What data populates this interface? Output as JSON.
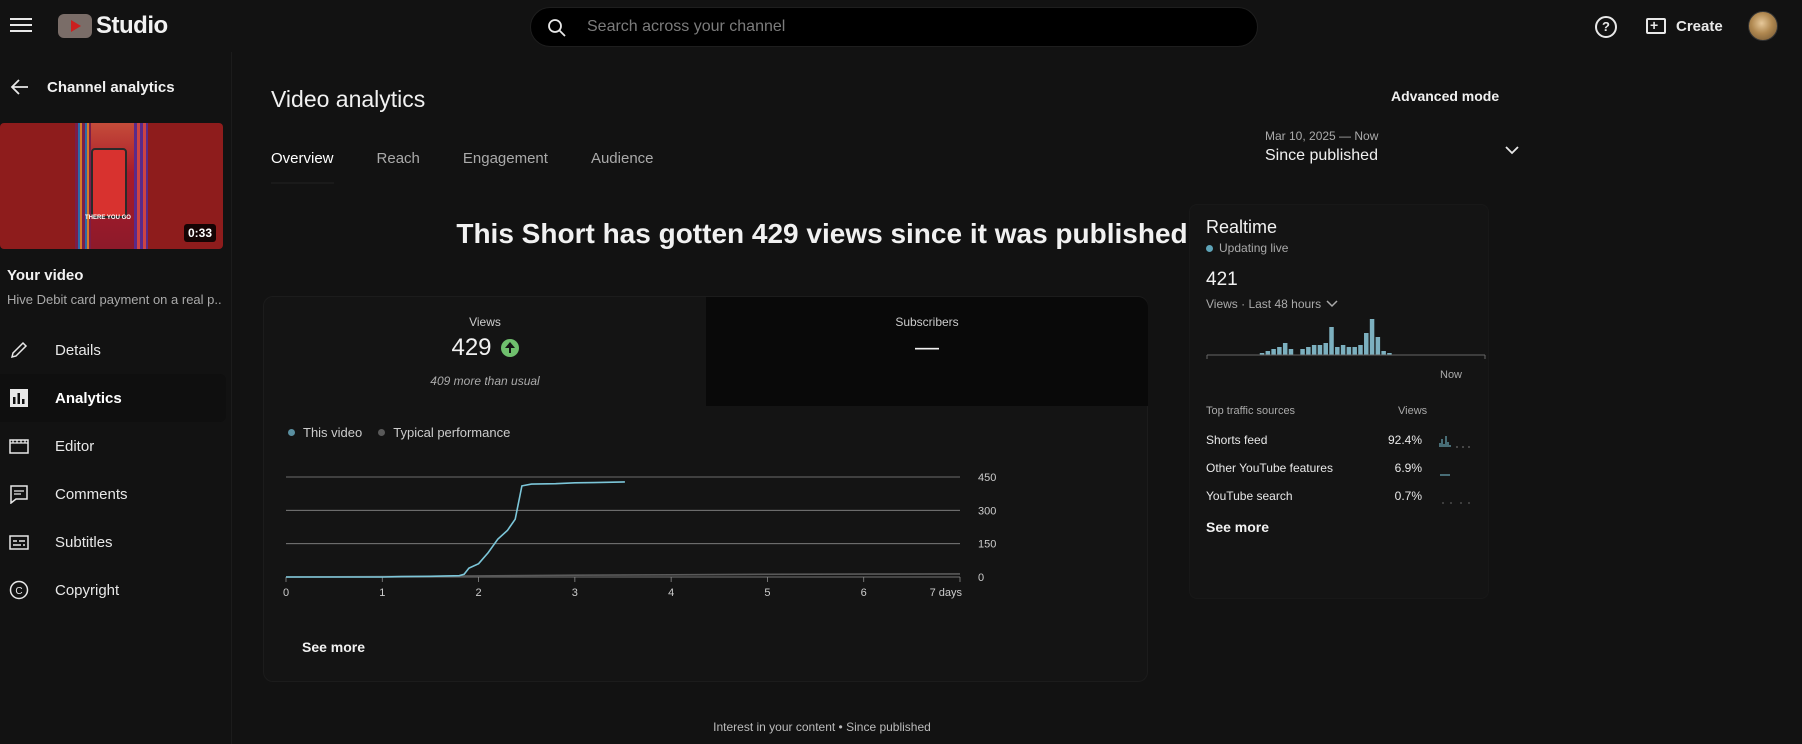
{
  "header": {
    "logo_text": "Studio",
    "search_placeholder": "Search across your channel",
    "create_label": "Create"
  },
  "sidebar": {
    "back_label": "Channel analytics",
    "thumbnail_caption": "THERE YOU GO",
    "duration": "0:33",
    "your_video_label": "Your video",
    "video_title": "Hive Debit card payment on a real p...",
    "items": [
      {
        "label": "Details",
        "icon": "pencil-icon",
        "active": false
      },
      {
        "label": "Analytics",
        "icon": "analytics-icon",
        "active": true
      },
      {
        "label": "Editor",
        "icon": "editor-icon",
        "active": false
      },
      {
        "label": "Comments",
        "icon": "comments-icon",
        "active": false
      },
      {
        "label": "Subtitles",
        "icon": "subtitles-icon",
        "active": false
      },
      {
        "label": "Copyright",
        "icon": "copyright-icon",
        "active": false
      }
    ]
  },
  "main": {
    "title": "Video analytics",
    "advanced_mode_label": "Advanced mode",
    "tabs": [
      {
        "label": "Overview",
        "active": true
      },
      {
        "label": "Reach",
        "active": false
      },
      {
        "label": "Engagement",
        "active": false
      },
      {
        "label": "Audience",
        "active": false
      }
    ],
    "date_range": {
      "range": "Mar 10, 2025 — Now",
      "label": "Since published"
    },
    "headline": "This Short has gotten 429 views since it was published",
    "metrics": {
      "views": {
        "label": "Views",
        "value": "429",
        "sub": "409 more than usual"
      },
      "subscribers": {
        "label": "Subscribers",
        "value": "—"
      }
    },
    "legend": {
      "this_video": "This video",
      "typical": "Typical performance"
    },
    "see_more_label": "See more",
    "interest_label": "Interest in your content • Since published"
  },
  "chart_data": {
    "type": "line",
    "x_tick_labels": [
      "0",
      "1",
      "2",
      "3",
      "4",
      "5",
      "6",
      "7 days"
    ],
    "y_tick_labels": [
      "450",
      "300",
      "150",
      "0"
    ],
    "xlim": [
      0,
      7
    ],
    "ylim": [
      0,
      450
    ],
    "series": [
      {
        "name": "This video",
        "color": "#7cc6d9",
        "points": [
          [
            0,
            0
          ],
          [
            0.5,
            0
          ],
          [
            1,
            0
          ],
          [
            1.2,
            2
          ],
          [
            1.5,
            3
          ],
          [
            1.8,
            6
          ],
          [
            1.85,
            12
          ],
          [
            1.9,
            40
          ],
          [
            2.0,
            60
          ],
          [
            2.1,
            110
          ],
          [
            2.2,
            170
          ],
          [
            2.3,
            210
          ],
          [
            2.38,
            260
          ],
          [
            2.45,
            410
          ],
          [
            2.55,
            418
          ],
          [
            2.8,
            420
          ],
          [
            3.0,
            424
          ],
          [
            3.2,
            425
          ],
          [
            3.52,
            428
          ]
        ]
      },
      {
        "name": "Typical performance",
        "color": "#5a5a5a",
        "points": [
          [
            0,
            0
          ],
          [
            1,
            2
          ],
          [
            2,
            5
          ],
          [
            3,
            8
          ],
          [
            4,
            10
          ],
          [
            5,
            12
          ],
          [
            6,
            13
          ],
          [
            7,
            14
          ]
        ]
      }
    ],
    "grid": true
  },
  "realtime": {
    "title": "Realtime",
    "status": "Updating live",
    "count": "421",
    "sub_label": "Views · Last 48 hours",
    "now_label": "Now",
    "bars": [
      0,
      0,
      0,
      0,
      0,
      0,
      0,
      0,
      0,
      1,
      2,
      3,
      4,
      6,
      3,
      0,
      3,
      4,
      5,
      5,
      6,
      14,
      4,
      5,
      4,
      4,
      5,
      11,
      18,
      9,
      2,
      1,
      0,
      0,
      0,
      0,
      0,
      0,
      0,
      0,
      0,
      0,
      0,
      0,
      0,
      0,
      0,
      0
    ],
    "traffic_head": {
      "source": "Top traffic sources",
      "views": "Views"
    },
    "traffic": [
      {
        "source": "Shorts feed",
        "pct": "92.4%"
      },
      {
        "source": "Other YouTube features",
        "pct": "6.9%"
      },
      {
        "source": "YouTube search",
        "pct": "0.7%"
      }
    ],
    "see_more_label": "See more"
  }
}
